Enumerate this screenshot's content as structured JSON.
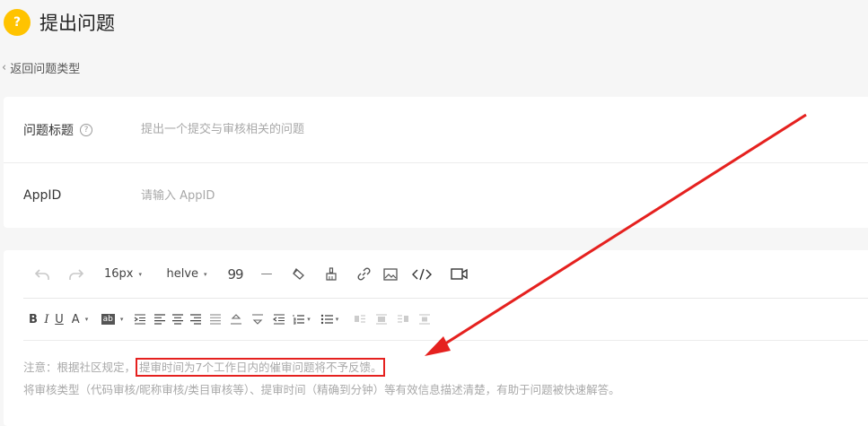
{
  "header": {
    "badge": "?",
    "title": "提出问题"
  },
  "back": {
    "chevron": "‹",
    "label": "返回问题类型"
  },
  "form": {
    "title_label": "问题标题",
    "title_help": "?",
    "title_placeholder": "提出一个提交与审核相关的问题",
    "appid_label": "AppID",
    "appid_placeholder": "请输入 AppID"
  },
  "toolbar": {
    "font_size": "16px",
    "font_family": "helve",
    "caret": "▾",
    "quote": "99",
    "hr": "—",
    "bold": "B",
    "italic": "I",
    "underline": "U",
    "font_color": "A",
    "bg_color": "ab"
  },
  "notice": {
    "line1_prefix": "注意：根据社区规定，",
    "line1_highlight": "提审时间为7个工作日内的催审问题将不予反馈。",
    "line2": "将审核类型（代码审核/昵称审核/类目审核等）、提审时间（精确到分钟）等有效信息描述清楚，有助于问题被快速解答。"
  },
  "colors": {
    "accent": "#ffc300",
    "annotation_red": "#e5211f",
    "placeholder": "#a8a8a8"
  },
  "icons": [
    "undo-icon",
    "redo-icon",
    "eraser-icon",
    "format-brush-icon",
    "link-icon",
    "image-icon",
    "code-icon",
    "video-icon",
    "line-height-icon",
    "align-left-icon",
    "align-center-icon",
    "align-right-icon",
    "justify-icon",
    "ordered-list-icon",
    "unordered-list-icon"
  ]
}
